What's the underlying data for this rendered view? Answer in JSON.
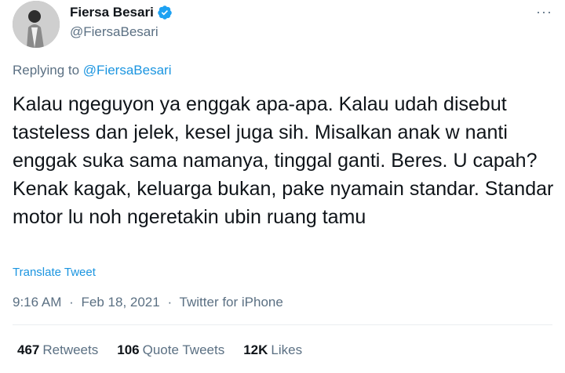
{
  "author": {
    "display_name": "Fiersa Besari",
    "handle": "@FiersaBesari",
    "verified": true,
    "avatar_icon": "profile-photo"
  },
  "more_icon": "more-horizontal-icon",
  "more_label": "···",
  "reply": {
    "prefix": "Replying to",
    "to": "@FiersaBesari"
  },
  "tweet": {
    "text": "Kalau ngeguyon ya enggak apa-apa. Kalau udah disebut tasteless dan jelek, kesel juga sih. Misalkan anak w nanti enggak suka sama namanya, tinggal ganti. Beres. U capah? Kenak kagak, keluarga bukan, pake nyamain standar. Standar motor lu noh ngeretakin ubin ruang tamu",
    "translate_label": "Translate Tweet"
  },
  "meta": {
    "time": "9:16 AM",
    "separator": "·",
    "date": "Feb 18, 2021",
    "source": "Twitter for iPhone"
  },
  "stats": [
    {
      "count": "467",
      "label": "Retweets"
    },
    {
      "count": "106",
      "label": "Quote Tweets"
    },
    {
      "count": "12K",
      "label": "Likes"
    }
  ],
  "colors": {
    "link": "#1b95e0",
    "secondary_text": "#5b7083",
    "primary_text": "#0f1419",
    "verified_badge": "#1da1f2",
    "divider": "#ebeef0"
  }
}
